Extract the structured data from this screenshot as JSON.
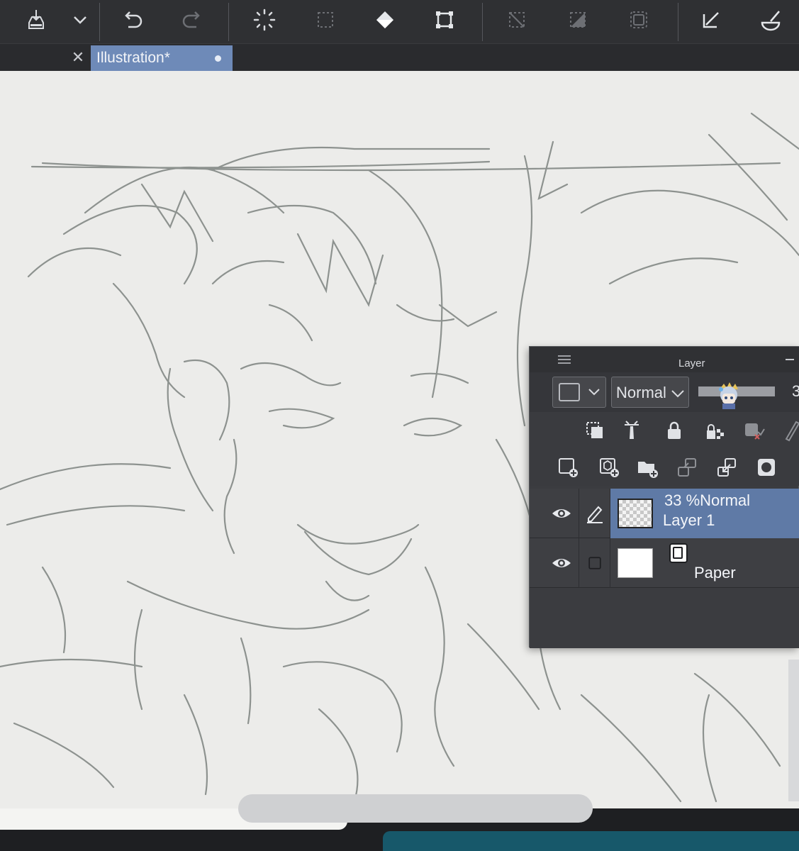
{
  "toolbar": {
    "buttons": [
      {
        "name": "save-button",
        "icon": "save-icon"
      },
      {
        "name": "save-menu-button",
        "icon": "chevron-down-icon"
      },
      {
        "name": "undo-button",
        "icon": "undo-icon"
      },
      {
        "name": "redo-button",
        "icon": "redo-icon"
      },
      {
        "name": "loading-indicator",
        "icon": "spinner-icon"
      },
      {
        "name": "select-all-button",
        "icon": "selection-icon"
      },
      {
        "name": "fill-button",
        "icon": "paint-bucket-icon"
      },
      {
        "name": "transform-button",
        "icon": "transform-icon"
      },
      {
        "name": "deselect-button",
        "icon": "deselect-icon"
      },
      {
        "name": "invert-selection-button",
        "icon": "invert-selection-icon"
      },
      {
        "name": "selection-border-button",
        "icon": "selection-border-icon"
      },
      {
        "name": "arrow-tool-button",
        "icon": "arrow-tool-icon"
      },
      {
        "name": "brush-tool-button",
        "icon": "brush-icon"
      }
    ]
  },
  "tab": {
    "title": "Illustration*",
    "close_icon": "close-icon"
  },
  "layer_panel": {
    "title": "Layer",
    "blend_mode": "Normal",
    "opacity_partial": "3",
    "opacity_fraction": 0.33,
    "layers": [
      {
        "opacity": "33 %",
        "mode": "Normal",
        "name": "Layer 1",
        "selected": true,
        "visible": true
      },
      {
        "name": "Paper",
        "selected": false,
        "visible": true
      }
    ],
    "icons_row1": [
      "clip-icon",
      "reference-layer-icon",
      "lock-icon",
      "lock-transparency-icon",
      "mask-toggle-icon",
      "ruler-icon"
    ],
    "icons_row2": [
      "new-raster-layer-icon",
      "new-vector-layer-icon",
      "new-folder-icon",
      "merge-down-icon",
      "transfer-icon",
      "mask-icon"
    ]
  },
  "colors": {
    "toolbar_bg": "#2f3033",
    "tab_active": "#6e8ab8",
    "layer_selected": "#5f7aa6",
    "canvas_bg": "#ececea",
    "sketch_stroke": "#8d928f"
  }
}
